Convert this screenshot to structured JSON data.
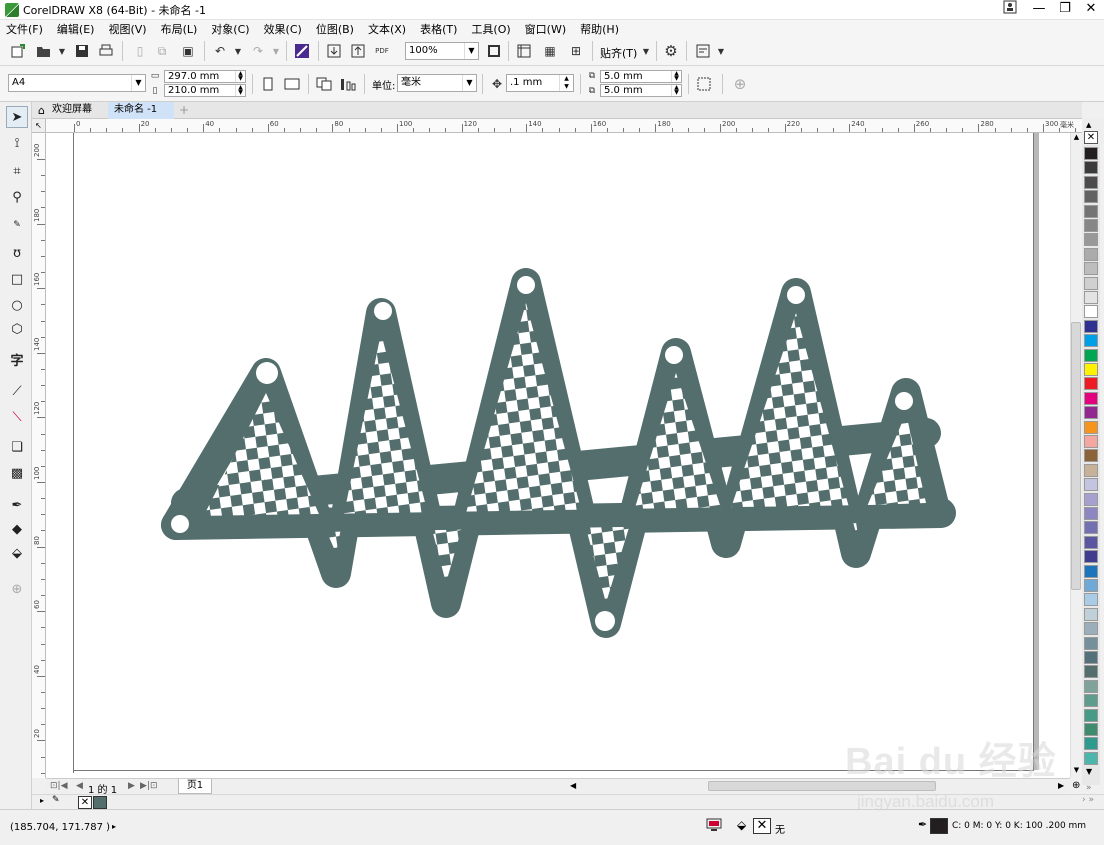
{
  "window": {
    "title": "CorelDRAW X8 (64-Bit) - 未命名 -1",
    "controls": [
      "minimize",
      "restore",
      "close"
    ]
  },
  "menubar": {
    "items": [
      "文件(F)",
      "编辑(E)",
      "视图(V)",
      "布局(L)",
      "对象(C)",
      "效果(C)",
      "位图(B)",
      "文本(X)",
      "表格(T)",
      "工具(O)",
      "窗口(W)",
      "帮助(H)"
    ]
  },
  "toolbar": {
    "zoom_value": "100%",
    "snap_label": "贴齐(T)"
  },
  "propertybar": {
    "page_size": "A4",
    "page_width": "297.0 mm",
    "page_height": "210.0 mm",
    "units_label": "单位:",
    "units_value": "毫米",
    "nudge_value": ".1 mm",
    "dup_x": "5.0 mm",
    "dup_y": "5.0 mm"
  },
  "tabs": {
    "welcome": "欢迎屏幕",
    "document": "未命名 -1",
    "add": "+"
  },
  "ruler": {
    "h_labels": [
      "0",
      "20",
      "40",
      "60",
      "80",
      "100",
      "120",
      "140",
      "160",
      "180",
      "200",
      "220",
      "240",
      "260",
      "280",
      "300"
    ],
    "h_unit": "毫米",
    "v_labels": [
      "200",
      "180",
      "160",
      "140",
      "120",
      "100",
      "80",
      "60",
      "40",
      "20"
    ]
  },
  "artwork": {
    "description_color": "#536e6c"
  },
  "pagenav": {
    "counter": "1 的 1",
    "page_tab": "页1"
  },
  "statusbar": {
    "cursor_coords": "(185.704, 171.787 )",
    "fill_label": "无",
    "outline_info": "C: 0 M: 0 Y: 0 K: 100  .200 mm"
  },
  "palette": {
    "colors": [
      "#231f20",
      "#3c3a3b",
      "#4d4b4c",
      "#636263",
      "#757475",
      "#878687",
      "#999899",
      "#ababab",
      "#bdbdbd",
      "#d0d0d0",
      "#e3e3e3",
      "#ffffff",
      "#2e3192",
      "#00a0e9",
      "#00a650",
      "#fff200",
      "#ed1c24",
      "#e4007f",
      "#92278f",
      "#f7941d",
      "#f4a7a0",
      "#8c6239",
      "#c7b299",
      "#c4c3e0",
      "#a5a0d0",
      "#8c87c2",
      "#7471b2",
      "#5a56a2",
      "#3f3b8f",
      "#1b75bc",
      "#6ea9d8",
      "#a9cbe6",
      "#bfd0d8",
      "#9aafb9",
      "#76909b",
      "#53707b",
      "#536e6c",
      "#7fa39a",
      "#5e9c8c",
      "#469b86",
      "#3e8b6e",
      "#2f9a8e",
      "#4db6ac"
    ]
  },
  "watermark": {
    "brand": "Bai du 经验",
    "url": "jingyan.baidu.com"
  }
}
